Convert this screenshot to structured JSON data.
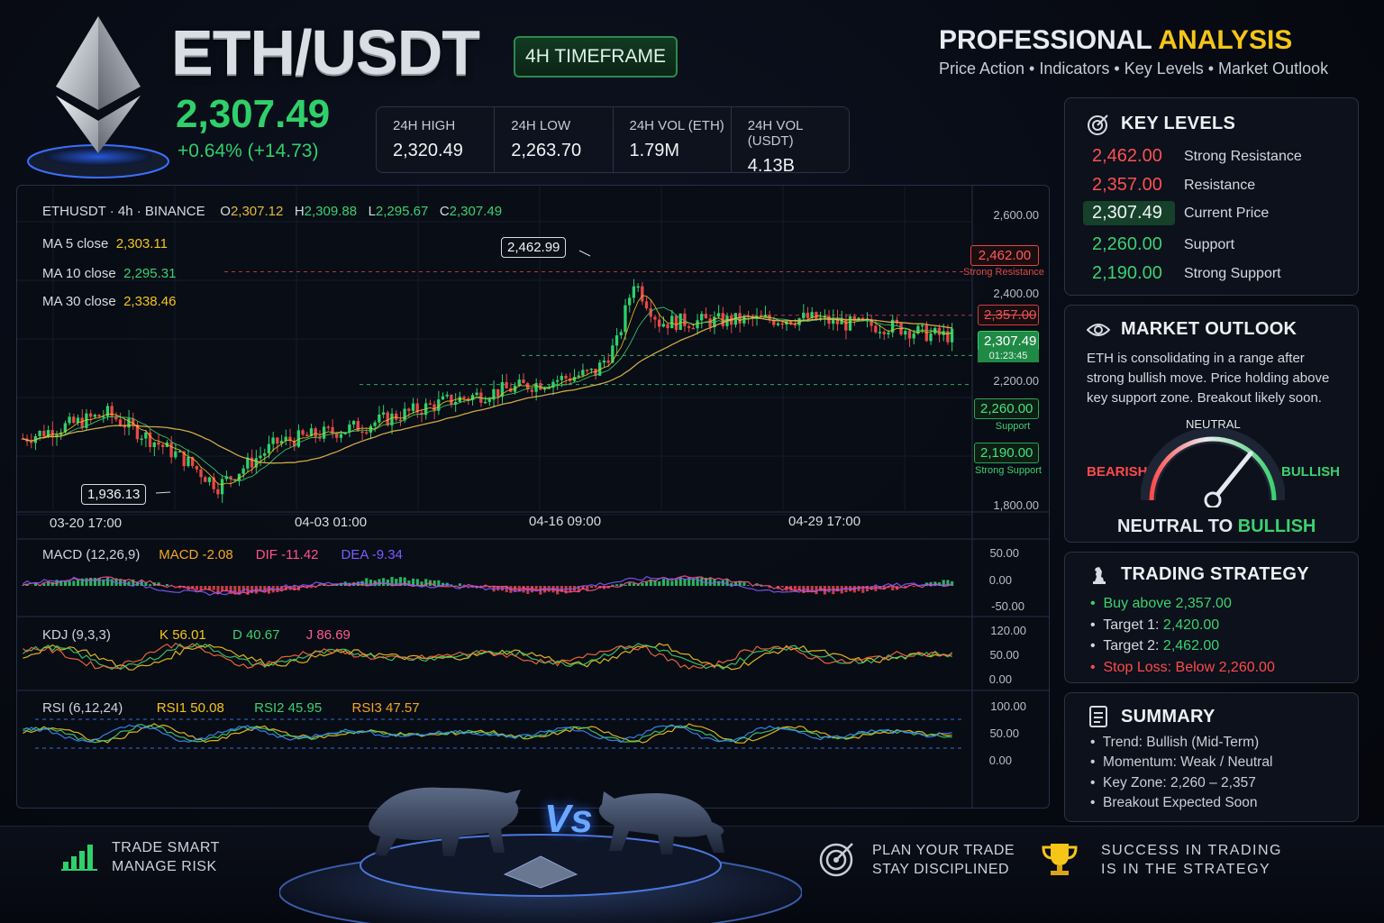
{
  "header": {
    "pair": "ETH/USDT",
    "timeframe": "4H TIMEFRAME",
    "price": "2,307.49",
    "change": "+0.64% (+14.73)",
    "stats": [
      {
        "label": "24H HIGH",
        "value": "2,320.49"
      },
      {
        "label": "24H LOW",
        "value": "2,263.70"
      },
      {
        "label": "24H VOL (ETH)",
        "value": "1.79M"
      },
      {
        "label": "24H VOL (USDT)",
        "value": "4.13B"
      }
    ],
    "pro_title_a": "PROFESSIONAL",
    "pro_title_b": "ANALYSIS",
    "pro_sub": "Price Action • Indicators • Key Levels • Market Outlook"
  },
  "chart": {
    "symbol": "ETHUSDT · 4h · BINANCE",
    "o": "2,307.12",
    "h": "2,309.88",
    "l": "2,295.67",
    "c": "2,307.49",
    "ma5_label": "MA 5 close",
    "ma5": "2,303.11",
    "ma10_label": "MA 10 close",
    "ma10": "2,295.31",
    "ma30_label": "MA 30 close",
    "ma30": "2,338.46",
    "y_ticks": [
      "2,600.00",
      "2,400.00",
      "2,200.00",
      "1,800.00"
    ],
    "tag_strong_res": "2,462.00",
    "tag_strong_res_lbl": "Strong Resistance",
    "tag_res": "2,357.00",
    "tag_cur": "2,307.49",
    "tag_timer": "01:23:45",
    "tag_sup": "2,260.00",
    "tag_sup_lbl": "Support",
    "tag_strong_sup": "2,190.00",
    "tag_strong_sup_lbl": "Strong Support",
    "high_callout": "2,462.99",
    "low_callout": "1,936.13",
    "dates": [
      "03-20  17:00",
      "04-03  01:00",
      "04-16  09:00",
      "04-29  17:00"
    ],
    "macd": {
      "label": "MACD (12,26,9)",
      "macd": "MACD  -2.08",
      "dif": "DIF  -11.42",
      "dea": "DEA  -9.34",
      "ticks": [
        "50.00",
        "0.00",
        "-50.00"
      ]
    },
    "kdj": {
      "label": "KDJ (9,3,3)",
      "k": "K  56.01",
      "d": "D  40.67",
      "j": "J  86.69",
      "ticks": [
        "120.00",
        "50.00",
        "0.00"
      ]
    },
    "rsi": {
      "label": "RSI (6,12,24)",
      "r1": "RSI1  50.08",
      "r2": "RSI2  45.95",
      "r3": "RSI3  47.57",
      "ticks": [
        "100.00",
        "50.00",
        "0.00"
      ]
    }
  },
  "chart_data": {
    "type": "candlestick",
    "x_dates": [
      "03-20 17:00",
      "04-03 01:00",
      "04-16 09:00",
      "04-29 17:00"
    ],
    "ylim": [
      1800,
      2600
    ],
    "key_prices": {
      "period_high": 2462.99,
      "period_low": 1936.13,
      "last_close": 2307.49
    },
    "levels": [
      {
        "name": "Strong Resistance",
        "price": 2462
      },
      {
        "name": "Resistance",
        "price": 2357
      },
      {
        "name": "Support",
        "price": 2260
      },
      {
        "name": "Strong Support",
        "price": 2190
      }
    ],
    "ma": {
      "ma5": 2303.11,
      "ma10": 2295.31,
      "ma30": 2338.46
    },
    "macd": {
      "macd": -2.08,
      "dif": -11.42,
      "dea": -9.34
    },
    "kdj": {
      "k": 56.01,
      "d": 40.67,
      "j": 86.69
    },
    "rsi": {
      "rsi1": 50.08,
      "rsi2": 45.95,
      "rsi3": 47.57
    }
  },
  "key_levels": {
    "title": "KEY LEVELS",
    "rows": [
      {
        "value": "2,462.00",
        "desc": "Strong Resistance"
      },
      {
        "value": "2,357.00",
        "desc": "Resistance"
      },
      {
        "value": "2,307.49",
        "desc": "Current Price"
      },
      {
        "value": "2,260.00",
        "desc": "Support"
      },
      {
        "value": "2,190.00",
        "desc": "Strong Support"
      }
    ]
  },
  "outlook": {
    "title": "MARKET OUTLOOK",
    "text": "ETH is consolidating in a range after strong bullish move. Price holding above key support zone. Breakout likely soon.",
    "neutral": "NEUTRAL",
    "bearish": "BEARISH",
    "bullish": "BULLISH",
    "verdict_a": "NEUTRAL TO",
    "verdict_b": "BULLISH"
  },
  "strategy": {
    "title": "TRADING STRATEGY",
    "buy": "Buy above 2,357.00",
    "t1_label": "Target 1:",
    "t1": "2,420.00",
    "t2_label": "Target 2:",
    "t2": "2,462.00",
    "stop": "Stop Loss: Below 2,260.00"
  },
  "summary": {
    "title": "SUMMARY",
    "items": [
      "Trend: Bullish (Mid-Term)",
      "Momentum: Weak / Neutral",
      "Key Zone: 2,260 – 2,357",
      "Breakout Expected Soon"
    ]
  },
  "footer": {
    "a1": "TRADE SMART",
    "a2": "MANAGE RISK",
    "vs": "Vs",
    "b1": "PLAN YOUR TRADE",
    "b2": "STAY DISCIPLINED",
    "c1": "SUCCESS IN TRADING",
    "c2": "IS IN THE STRATEGY"
  },
  "colors": {
    "up": "#2fd06a",
    "down": "#e84848",
    "accent": "#f5c518"
  }
}
